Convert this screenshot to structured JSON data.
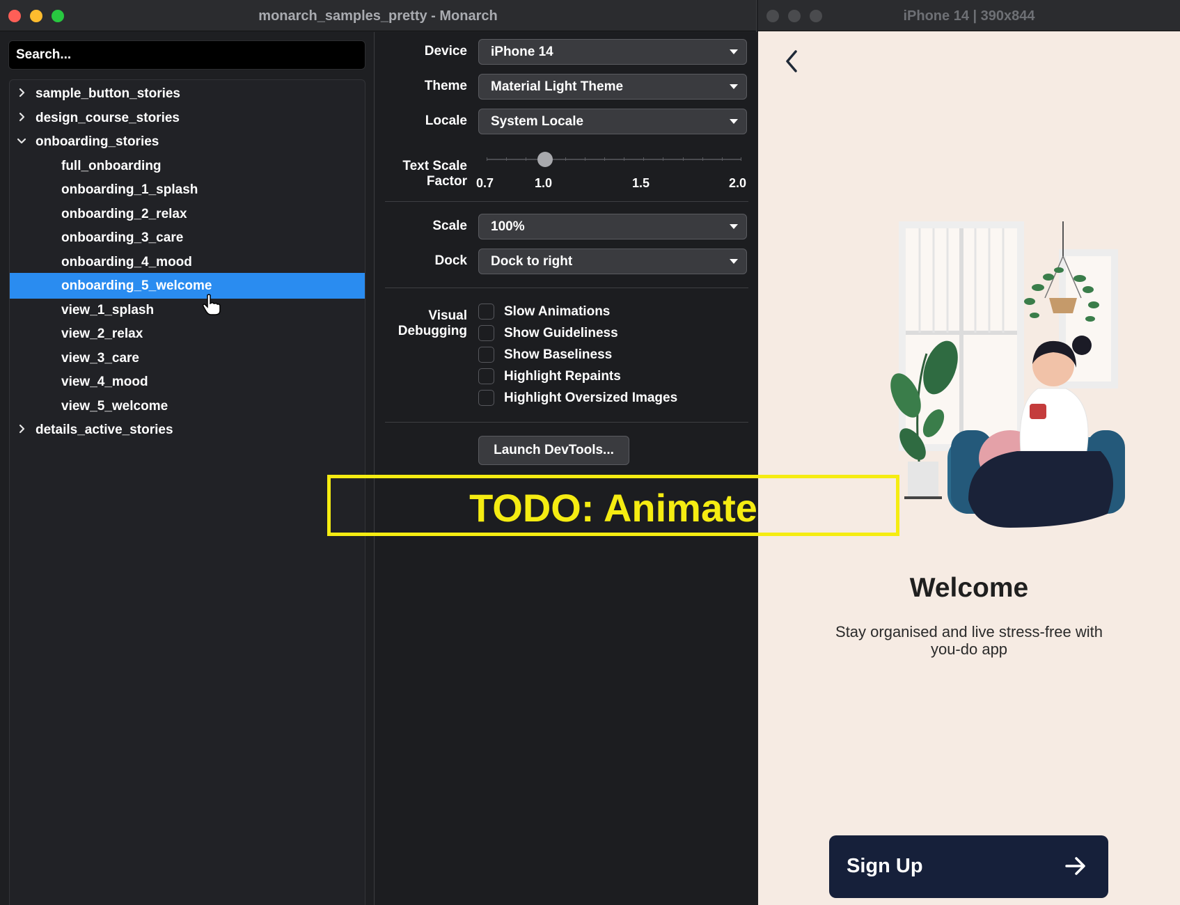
{
  "monarch": {
    "title": "monarch_samples_pretty - Monarch",
    "search_placeholder": "Search...",
    "tree": [
      {
        "label": "sample_button_stories",
        "expander": "chevron-right-icon"
      },
      {
        "label": "design_course_stories",
        "expander": "chevron-right-icon"
      },
      {
        "label": "onboarding_stories",
        "expander": "chevron-down-icon"
      },
      {
        "label": "full_onboarding"
      },
      {
        "label": "onboarding_1_splash"
      },
      {
        "label": "onboarding_2_relax"
      },
      {
        "label": "onboarding_3_care"
      },
      {
        "label": "onboarding_4_mood"
      },
      {
        "label": "onboarding_5_welcome",
        "selected": true
      },
      {
        "label": "view_1_splash"
      },
      {
        "label": "view_2_relax"
      },
      {
        "label": "view_3_care"
      },
      {
        "label": "view_4_mood"
      },
      {
        "label": "view_5_welcome"
      },
      {
        "label": "details_active_stories",
        "expander": "chevron-right-icon"
      }
    ],
    "settings": {
      "device_label": "Device",
      "device_value": "iPhone 14",
      "theme_label": "Theme",
      "theme_value": "Material Light Theme",
      "locale_label": "Locale",
      "locale_value": "System Locale",
      "text_scale_label_1": "Text Scale",
      "text_scale_label_2": "Factor",
      "text_scale_ticks": [
        "0.7",
        "1.0",
        "1.5",
        "2.0"
      ],
      "text_scale_value": 1.0,
      "scale_label": "Scale",
      "scale_value": "100%",
      "dock_label": "Dock",
      "dock_value": "Dock to right",
      "visual_label_1": "Visual",
      "visual_label_2": "Debugging",
      "checks": [
        "Slow Animations",
        "Show Guideliness",
        "Show Baseliness",
        "Highlight Repaints",
        "Highlight Oversized Images"
      ],
      "devtools_label": "Launch DevTools..."
    }
  },
  "phone": {
    "title": "iPhone 14 | 390x844",
    "welcome": "Welcome",
    "subtitle": "Stay organised and live stress-free with you-do app",
    "signup_label": "Sign Up"
  },
  "overlay": {
    "todo": "TODO: Animate"
  },
  "colors": {
    "selection": "#2a8cf0",
    "phone_bg": "#f6ebe3",
    "button_bg": "#16203a",
    "todo_yellow": "#f5ec12"
  }
}
